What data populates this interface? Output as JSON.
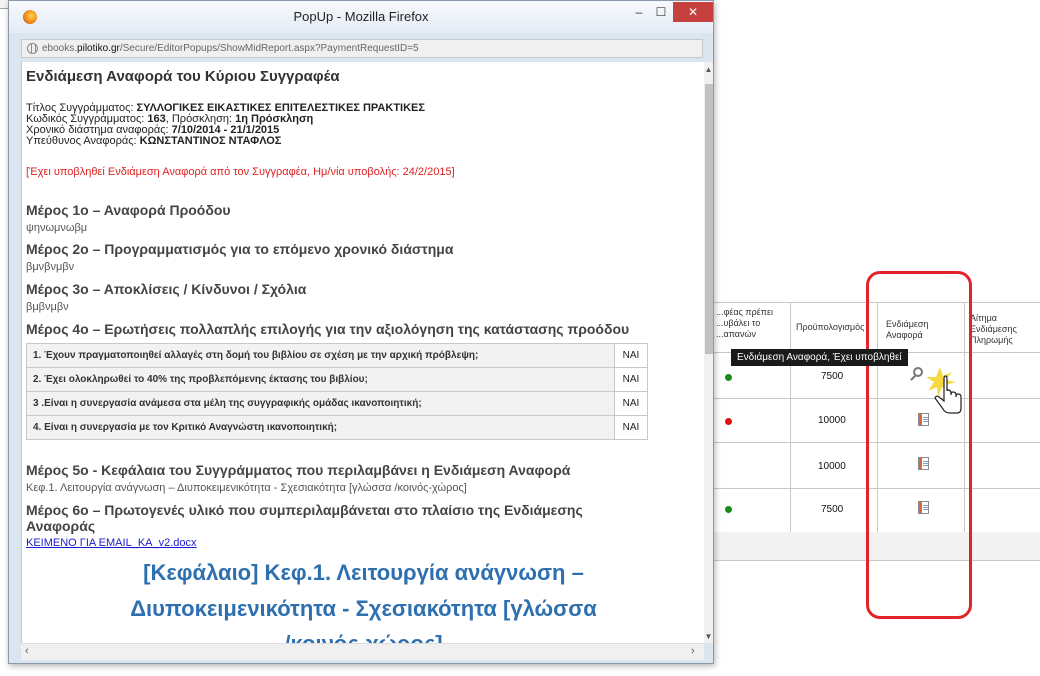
{
  "bg_page": {
    "col_headers": {
      "must_submit": "...φέας πρέπει ...υβάλει το ...απανών",
      "budget": "Προϋπολογισμός",
      "mid_report": "Ενδιάμεση Αναφορά",
      "payment_request": "Αίτημα Ενδιάμεσης Πληρωμής"
    },
    "tooltip": "Ενδιάμεση Αναφορά, Έχει υποβληθεί",
    "rows": [
      {
        "status_color": "#1a8a1a",
        "budget": "7500",
        "icon": "magnifier-icon"
      },
      {
        "status_color": "#e01010",
        "budget": "10000",
        "icon": "document-icon"
      },
      {
        "status_color": "",
        "budget": "10000",
        "icon": "document-icon"
      },
      {
        "status_color": "#1a8a1a",
        "budget": "7500",
        "icon": "document-icon"
      }
    ],
    "highlight_color": "#e0242a"
  },
  "window": {
    "title": "PopUp - Mozilla Firefox",
    "controls": {
      "minimize": "–",
      "maximize": "☐",
      "close": "✕"
    },
    "url_prefix": "ebooks.",
    "url_domain": "pilotiko.gr",
    "url_path": "/Secure/EditorPopups/ShowMidReport.aspx?PaymentRequestID=5"
  },
  "report": {
    "heading": "Ενδιάμεση Αναφορά του Κύριου Συγγραφέα",
    "meta": [
      {
        "label": "Τίτλος Συγγράμματος: ",
        "value": "ΣΥΛΛΟΓΙΚΕΣ ΕΙΚΑΣΤΙΚΕΣ ΕΠΙΤΕΛΕΣΤΙΚΕΣ ΠΡΑΚΤΙΚΕΣ",
        "tail": ""
      },
      {
        "label": "Κωδικός Συγγράμματος: ",
        "value": "163",
        "tail": ", Πρόσκληση: ",
        "value2": "1η Πρόσκληση"
      },
      {
        "label": "Χρονικό διάστημα αναφοράς: ",
        "value": "7/10/2014 - 21/1/2015",
        "tail": ""
      },
      {
        "label": "Υπεύθυνος Αναφοράς: ",
        "value": "ΚΩΝΣΤΑΝΤΙΝΟΣ ΝΤΑΦΛΟΣ",
        "tail": ""
      }
    ],
    "status_note": "[Έχει υποβληθεί Ενδιάμεση Αναφορά από τον Συγγραφέα, Ημ/νία υποβολής: 24/2/2015]",
    "part1_title": "Μέρος 1ο – Αναφορά Προόδου",
    "part1_text": "ψηνωμνωβμ",
    "part2_title": "Μέρος 2ο – Προγραμματισμός για το επόμενο χρονικό διάστημα",
    "part2_text": "βμνβνμβν",
    "part3_title": "Μέρος 3ο – Αποκλίσεις / Κίνδυνοι / Σχόλια",
    "part3_text": "βμβνμβν",
    "part4_title": "Μέρος 4ο – Ερωτήσεις πολλαπλής επιλογής για την αξιολόγηση της κατάστασης προόδου",
    "questions": [
      {
        "q": "1. Έχουν πραγματοποιηθεί αλλαγές στη δομή του βιβλίου σε σχέση με την αρχική πρόβλεψη;",
        "a": "ΝΑΙ"
      },
      {
        "q": "2. Έχει ολοκληρωθεί το 40% της προβλεπόμενης έκτασης του βιβλίου;",
        "a": "ΝΑΙ"
      },
      {
        "q": "3 .Είναι η συνεργασία ανάμεσα στα μέλη της συγγραφικής ομάδας ικανοποιητική;",
        "a": "ΝΑΙ"
      },
      {
        "q": "4. Είναι η συνεργασία με τον Κριτικό Αναγνώστη ικανοποιητική;",
        "a": "ΝΑΙ"
      }
    ],
    "part5_title": "Μέρος 5ο - Κεφάλαια του Συγγράμματος που περιλαμβάνει η Ενδιάμεση Αναφορά",
    "part5_text": "Κεφ.1. Λειτουργία ανάγνωση – Διυποκειμενικότητα - Σχεσιακότητα [γλώσσα /κοινός-χώρος]",
    "part6_title_line1": "Μέρος 6ο – Πρωτογενές υλικό που συμπεριλαμβάνεται στο πλαίσιο της Ενδιάμεσης",
    "part6_title_line2": "Αναφοράς",
    "attachment": "ΚΕΙΜΕΝΟ ΓΙΑ EMAIL_ΚΑ_v2.docx",
    "doc_heading_line1": "[Κεφάλαιο] Κεφ.1. Λειτουργία ανάγνωση –",
    "doc_heading_line2": "Διυποκειμενικότητα - Σχεσιακότητα [γλώσσα",
    "doc_heading_line3": "/κοινός-χώρος]"
  }
}
